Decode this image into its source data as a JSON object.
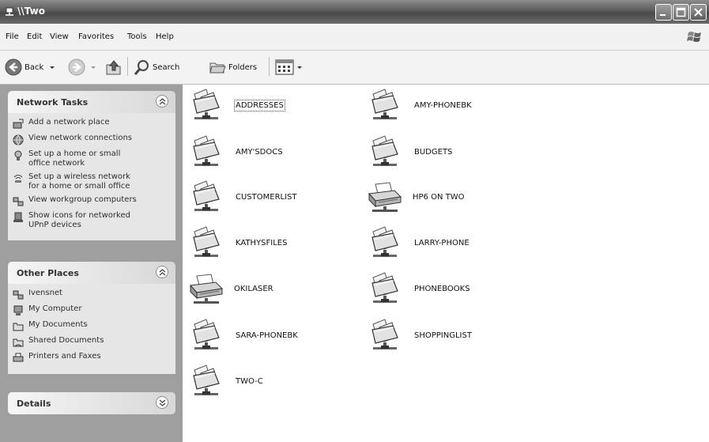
{
  "window": {
    "title": "\\\\Two"
  },
  "menu": [
    "File",
    "Edit",
    "View",
    "Favorites",
    "Tools",
    "Help"
  ],
  "toolbar": {
    "back_label": "Back",
    "search_label": "Search",
    "folders_label": "Folders"
  },
  "sidebar": {
    "network_tasks": {
      "title": "Network Tasks",
      "items": [
        "Add a network place",
        "View network connections",
        "Set up a home or small\noffice network",
        "Set up a wireless network\nfor a home or small office",
        "View workgroup computers",
        "Show icons for networked\nUPnP devices"
      ]
    },
    "other_places": {
      "title": "Other Places",
      "items": [
        "Ivensnet",
        "My Computer",
        "My Documents",
        "Shared Documents",
        "Printers and Faxes"
      ]
    },
    "details": {
      "title": "Details"
    }
  },
  "items": [
    {
      "label": "ADDRESSES",
      "type": "share"
    },
    {
      "label": "AMY-PHONEBK",
      "type": "share"
    },
    {
      "label": "AMY'SDOCS",
      "type": "share"
    },
    {
      "label": "BUDGETS",
      "type": "share"
    },
    {
      "label": "CUSTOMERLIST",
      "type": "share"
    },
    {
      "label": "HP6 ON TWO",
      "type": "printer"
    },
    {
      "label": "KATHYSFILES",
      "type": "share"
    },
    {
      "label": "LARRY-PHONE",
      "type": "share"
    },
    {
      "label": "OKILASER",
      "type": "printer"
    },
    {
      "label": "PHONEBOOKS",
      "type": "share"
    },
    {
      "label": "SARA-PHONEBK",
      "type": "share"
    },
    {
      "label": "SHOPPINGLIST",
      "type": "share"
    },
    {
      "label": "TWO-C",
      "type": "share"
    }
  ]
}
